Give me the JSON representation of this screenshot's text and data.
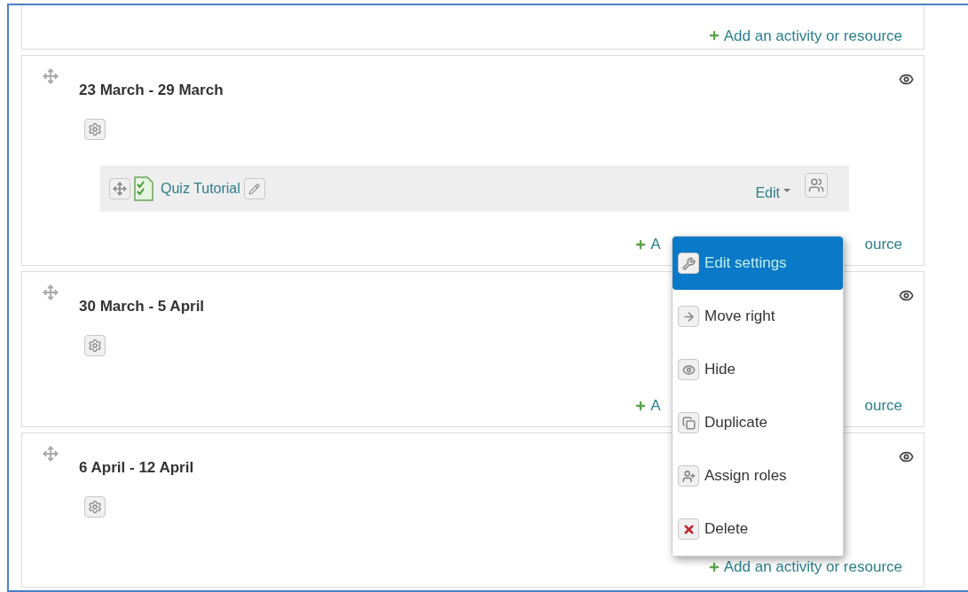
{
  "top_section": {
    "add_link": {
      "kind": "full",
      "label": "Add an activity or resource"
    }
  },
  "sections": [
    {
      "title": "23 March - 29 March",
      "activities": [
        {
          "name": "Quiz Tutorial",
          "edit_label": "Edit"
        }
      ],
      "add_link": {
        "kind": "covered",
        "start": "A",
        "end": "ource"
      }
    },
    {
      "title": "30 March - 5 April",
      "add_link": {
        "kind": "covered",
        "start": "A",
        "end": "ource"
      }
    },
    {
      "title": "6 April - 12 April",
      "add_link": {
        "kind": "full",
        "label": "Add an activity or resource"
      }
    }
  ],
  "edit_menu": {
    "items": [
      {
        "kind": "wrench",
        "label": "Edit settings",
        "selected": true
      },
      {
        "kind": "arrow",
        "label": "Move right",
        "selected": false
      },
      {
        "kind": "eye",
        "label": "Hide",
        "selected": false
      },
      {
        "kind": "copy",
        "label": "Duplicate",
        "selected": false
      },
      {
        "kind": "assign",
        "label": "Assign roles",
        "selected": false
      },
      {
        "kind": "delete",
        "label": "Delete",
        "selected": false
      }
    ]
  }
}
